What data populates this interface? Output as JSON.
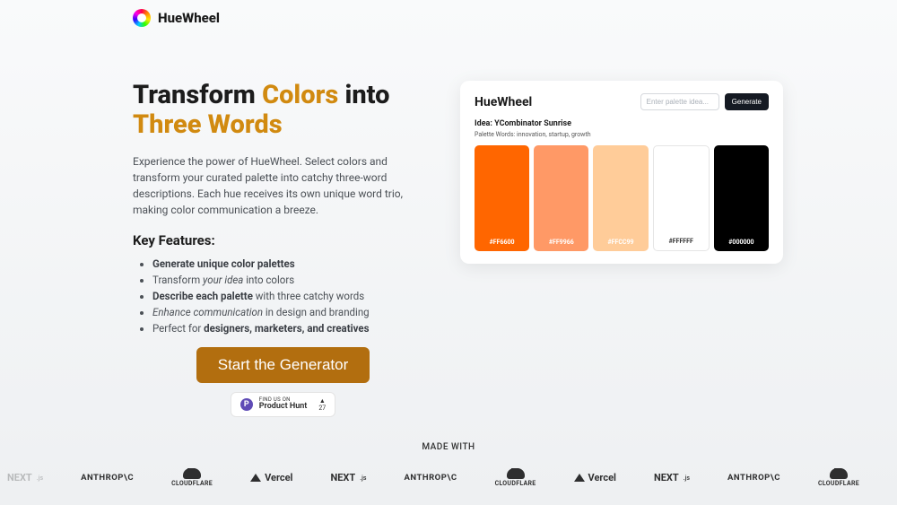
{
  "brand": "HueWheel",
  "hero": {
    "title_prefix": "Transform ",
    "title_accent1": "Colors",
    "title_mid": " into ",
    "title_accent2": "Three Words",
    "desc": "Experience the power of HueWheel. Select colors and transform your curated palette into catchy three-word descriptions. Each hue receives its own unique word trio, making color communication a breeze.",
    "features_title": "Key Features:",
    "features": {
      "f0a": "Generate unique color palettes",
      "f1a": "Transform ",
      "f1b": "your idea",
      "f1c": " into colors",
      "f2a": "Describe each palette",
      "f2b": " with three catchy words",
      "f3a": "Enhance communication",
      "f3b": " in design and branding",
      "f4a": "Perfect for ",
      "f4b": "designers, marketers, and creatives"
    },
    "cta": "Start the Generator",
    "ph": {
      "top": "FIND US ON",
      "bottom": "Product Hunt",
      "count": "27"
    }
  },
  "card": {
    "title": "HueWheel",
    "placeholder": "Enter palette idea...",
    "generate": "Generate",
    "idea_label": "Idea: YCombinator Sunrise",
    "words_label": "Palette Words: innovation, startup, growth",
    "swatches": [
      {
        "hex": "#FF6600",
        "color": "#FF6600",
        "dark": false
      },
      {
        "hex": "#FF9966",
        "color": "#FF9966",
        "dark": false
      },
      {
        "hex": "#FFCC99",
        "color": "#FFCC99",
        "dark": false
      },
      {
        "hex": "#FFFFFF",
        "color": "#FFFFFF",
        "dark": true,
        "bordered": true
      },
      {
        "hex": "#000000",
        "color": "#000000",
        "dark": false
      }
    ]
  },
  "made": {
    "label": "MADE WITH",
    "next": "NEXT",
    "next_sub": ".js",
    "anthropic": "ANTHROP\\C",
    "cloudflare": "CLOUDFLARE",
    "vercel": "Vercel"
  }
}
